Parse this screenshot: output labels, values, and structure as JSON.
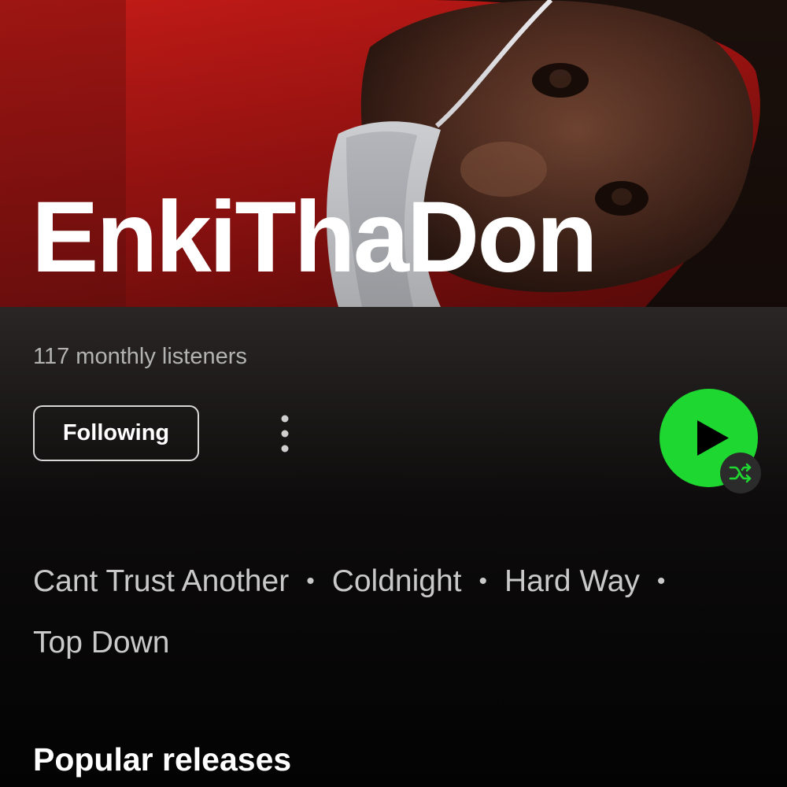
{
  "artist": {
    "name": "EnkiThaDon",
    "monthly_listeners": "117 monthly listeners"
  },
  "actions": {
    "follow_label": "Following",
    "more_icon": "more-vertical-icon",
    "play_icon": "play-icon",
    "shuffle_icon": "shuffle-icon"
  },
  "top_tracks": [
    "Cant Trust Another",
    "Coldnight",
    "Hard Way",
    "Top Down"
  ],
  "track_separator": "•",
  "sections": {
    "popular_releases": "Popular releases"
  },
  "colors": {
    "accent": "#1ed730",
    "background": "#000000",
    "secondary_text": "#b3b3b3"
  }
}
